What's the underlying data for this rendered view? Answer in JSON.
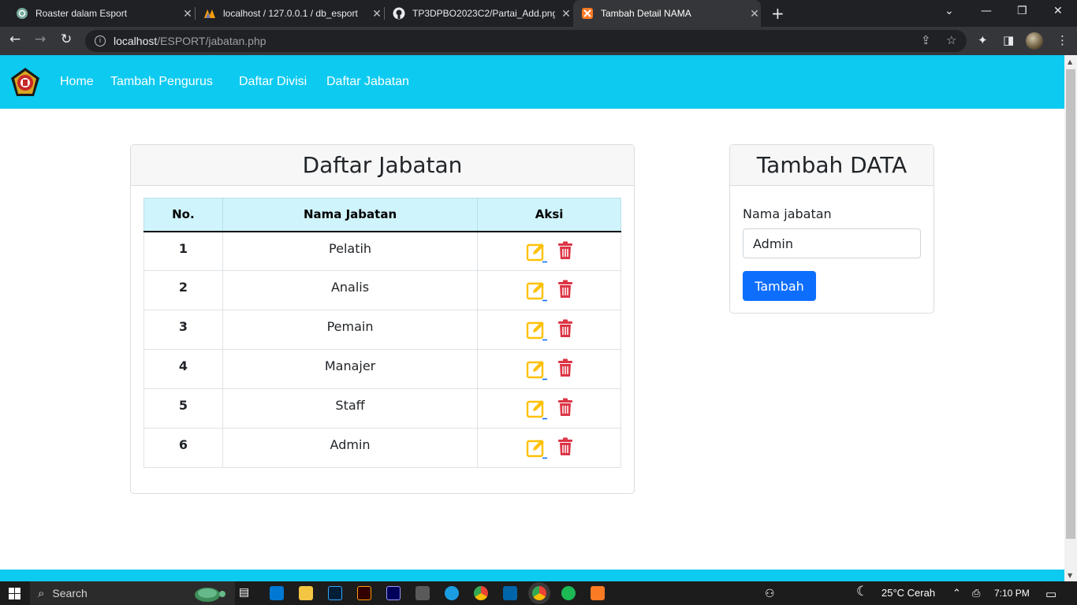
{
  "browser": {
    "tabs": [
      {
        "title": "Roaster dalam Esport",
        "active": false,
        "icon": "openai-icon"
      },
      {
        "title": "localhost / 127.0.0.1 / db_esport",
        "active": false,
        "icon": "phpmyadmin-icon"
      },
      {
        "title": "TP3DPBO2023C2/Partai_Add.png",
        "active": false,
        "icon": "github-icon"
      },
      {
        "title": "Tambah Detail NAMA",
        "active": true,
        "icon": "xampp-icon"
      }
    ],
    "url_host": "localhost",
    "url_path": "/ESPORT/jabatan.php"
  },
  "navbar": {
    "links": [
      "Home",
      "Tambah Pengurus",
      "Daftar Divisi",
      "Daftar Jabatan"
    ]
  },
  "list_card": {
    "title": "Daftar Jabatan",
    "columns": [
      "No.",
      "Nama Jabatan",
      "Aksi"
    ],
    "rows": [
      {
        "no": "1",
        "nama": "Pelatih"
      },
      {
        "no": "2",
        "nama": "Analis"
      },
      {
        "no": "3",
        "nama": "Pemain"
      },
      {
        "no": "4",
        "nama": "Manajer"
      },
      {
        "no": "5",
        "nama": "Staff"
      },
      {
        "no": "6",
        "nama": "Admin"
      }
    ]
  },
  "form_card": {
    "title": "Tambah DATA",
    "label": "Nama jabatan",
    "input_value": "Admin",
    "submit_label": "Tambah"
  },
  "taskbar": {
    "search_label": "Search",
    "weather": "25°C  Cerah",
    "time": "7:10 PM"
  },
  "colors": {
    "navbar": "#0dcaf0",
    "table_header": "#cff4fc",
    "primary_button": "#0d6efd",
    "edit_icon": "#ffc107",
    "delete_icon": "#dc3545"
  }
}
